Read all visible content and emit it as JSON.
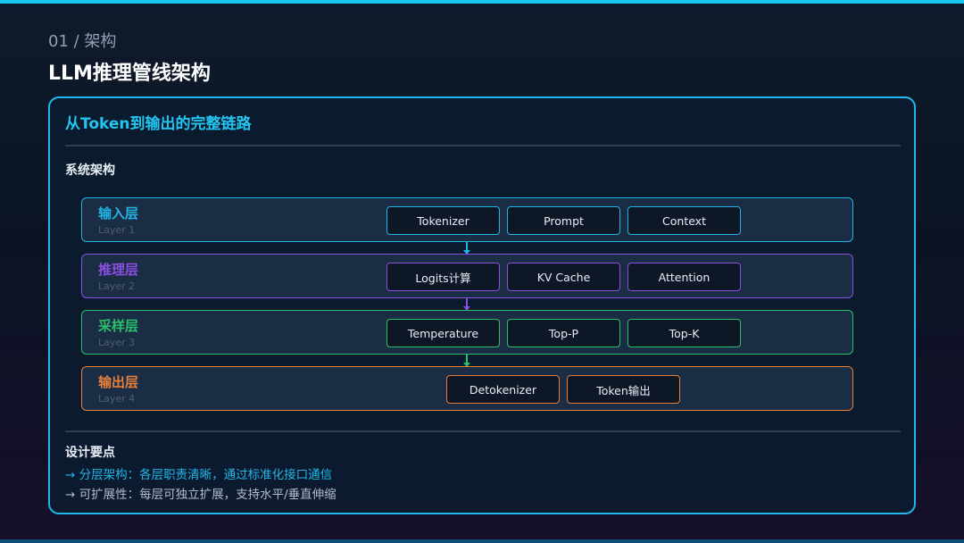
{
  "header": {
    "section_label": "01 / 架构",
    "title": "LLM推理管线架构"
  },
  "card": {
    "title": "从Token到输出的完整链路",
    "subtitle": "系统架构"
  },
  "colors": {
    "input": "#1fb4e4",
    "inference": "#8a4ee0",
    "sampling": "#2bbf6a",
    "output": "#e57f3a"
  },
  "layers": [
    {
      "name": "输入层",
      "sub": "Layer 1",
      "components": [
        "Tokenizer",
        "Prompt",
        "Context"
      ]
    },
    {
      "name": "推理层",
      "sub": "Layer 2",
      "components": [
        "Logits计算",
        "KV Cache",
        "Attention"
      ]
    },
    {
      "name": "采样层",
      "sub": "Layer 3",
      "components": [
        "Temperature",
        "Top-P",
        "Top-K"
      ]
    },
    {
      "name": "输出层",
      "sub": "Layer 4",
      "components": [
        "Detokenizer",
        "Token输出"
      ]
    }
  ],
  "notes": {
    "title": "设计要点",
    "items": [
      "→ 分层架构：各层职责清晰，通过标准化接口通信",
      "→ 可扩展性：每层可独立扩展，支持水平/垂直伸缩"
    ]
  }
}
